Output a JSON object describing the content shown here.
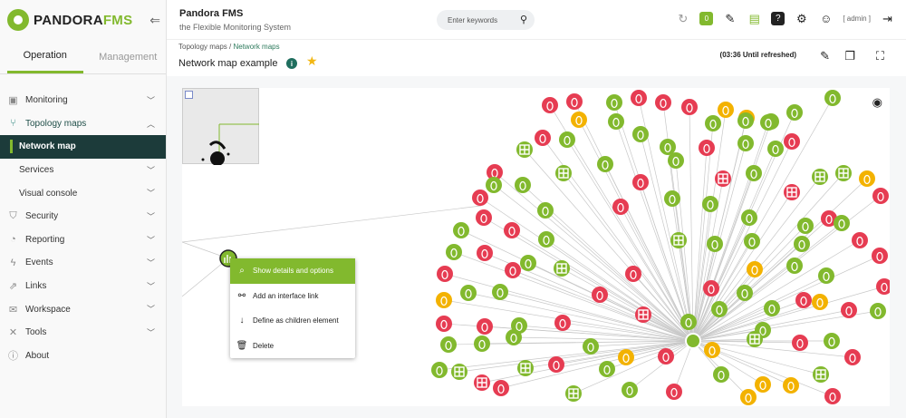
{
  "logo": {
    "part1": "PANDORA",
    "part2": "FMS"
  },
  "sidebar": {
    "tabs": [
      {
        "label": "Operation"
      },
      {
        "label": "Management"
      }
    ],
    "items": [
      {
        "label": "Monitoring",
        "icon": "monitor-icon"
      },
      {
        "label": "Topology maps",
        "icon": "topology-icon"
      },
      {
        "label": "Network map",
        "icon": ""
      },
      {
        "label": "Services",
        "icon": ""
      },
      {
        "label": "Visual console",
        "icon": ""
      },
      {
        "label": "Security",
        "icon": "shield-icon"
      },
      {
        "label": "Reporting",
        "icon": "pie-chart-icon"
      },
      {
        "label": "Events",
        "icon": "bolt-icon"
      },
      {
        "label": "Links",
        "icon": "external-link-icon"
      },
      {
        "label": "Workspace",
        "icon": "envelope-icon"
      },
      {
        "label": "Tools",
        "icon": "tools-icon"
      },
      {
        "label": "About",
        "icon": "info-icon"
      }
    ]
  },
  "header": {
    "title": "Pandora FMS",
    "subtitle": "the Flexible Monitoring System",
    "search_placeholder": "Enter keywords",
    "badge_count": "0",
    "user": "[ admin ]"
  },
  "subheader": {
    "breadcrumb_root": "Topology maps",
    "breadcrumb_sep": " / ",
    "breadcrumb_current": "Network maps",
    "page_title": "Network map example",
    "refresh_text": "(03:36 Until refreshed)"
  },
  "context_menu": {
    "items": [
      {
        "label": "Show details and options",
        "icon": "search-icon"
      },
      {
        "label": "Add an interface link",
        "icon": "link-icon"
      },
      {
        "label": "Define as children element",
        "icon": "arrow-down-icon"
      },
      {
        "label": "Delete",
        "icon": "trash-icon"
      }
    ]
  },
  "colors": {
    "green": "#82b92e",
    "red": "#e63c52",
    "orange": "#f3b200",
    "dark": "#1c3b3a"
  }
}
